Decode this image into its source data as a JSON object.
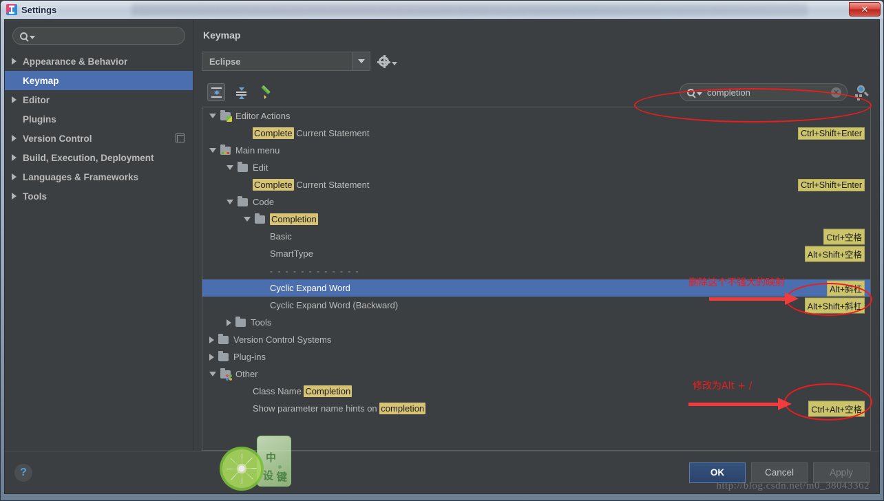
{
  "window": {
    "title": "Settings",
    "close_label": "✕"
  },
  "sidebar": {
    "search_placeholder": "",
    "search_value": "",
    "items": [
      {
        "label": "Appearance & Behavior",
        "expandable": true,
        "selected": false,
        "badge": false
      },
      {
        "label": "Keymap",
        "expandable": false,
        "selected": true,
        "badge": false
      },
      {
        "label": "Editor",
        "expandable": true,
        "selected": false,
        "badge": false
      },
      {
        "label": "Plugins",
        "expandable": false,
        "selected": false,
        "badge": false
      },
      {
        "label": "Version Control",
        "expandable": true,
        "selected": false,
        "badge": true
      },
      {
        "label": "Build, Execution, Deployment",
        "expandable": true,
        "selected": false,
        "badge": false
      },
      {
        "label": "Languages & Frameworks",
        "expandable": true,
        "selected": false,
        "badge": false
      },
      {
        "label": "Tools",
        "expandable": true,
        "selected": false,
        "badge": false
      }
    ]
  },
  "keymap": {
    "page_title": "Keymap",
    "selected_scheme": "Eclipse",
    "toolbar": {
      "expand_all_tooltip": "Expand All",
      "collapse_all_tooltip": "Collapse All",
      "edit_shortcut_tooltip": "Edit Shortcut"
    },
    "search": {
      "value": "completion",
      "placeholder": "",
      "clear_label": "✕"
    },
    "tree": [
      {
        "indent": 0,
        "arrow": "open",
        "icon": "folder-editor",
        "text": "Editor Actions",
        "highlight": "",
        "shortcut": "",
        "selected": false
      },
      {
        "indent": 2,
        "arrow": "none",
        "icon": "none",
        "text": "Complete Current Statement",
        "highlight": "Complete",
        "shortcut": "Ctrl+Shift+Enter",
        "selected": false
      },
      {
        "indent": 0,
        "arrow": "open",
        "icon": "folder-menu",
        "text": "Main menu",
        "highlight": "",
        "shortcut": "",
        "selected": false
      },
      {
        "indent": 1,
        "arrow": "open",
        "icon": "folder",
        "text": "Edit",
        "highlight": "",
        "shortcut": "",
        "selected": false
      },
      {
        "indent": 2,
        "arrow": "none",
        "icon": "none",
        "text": "Complete Current Statement",
        "highlight": "Complete",
        "shortcut": "Ctrl+Shift+Enter",
        "selected": false
      },
      {
        "indent": 1,
        "arrow": "open",
        "icon": "folder",
        "text": "Code",
        "highlight": "",
        "shortcut": "",
        "selected": false
      },
      {
        "indent": 2,
        "arrow": "open",
        "icon": "folder",
        "text": "Completion",
        "highlight": "Completion",
        "shortcut": "",
        "selected": false
      },
      {
        "indent": 3,
        "arrow": "none",
        "icon": "none",
        "text": "Basic",
        "highlight": "",
        "shortcut": "Ctrl+空格",
        "selected": false
      },
      {
        "indent": 3,
        "arrow": "none",
        "icon": "none",
        "text": "SmartType",
        "highlight": "",
        "shortcut": "Alt+Shift+空格",
        "selected": false
      },
      {
        "indent": 3,
        "arrow": "none",
        "icon": "none",
        "text": "- - - - - - - - - - - -",
        "highlight": "",
        "shortcut": "",
        "selected": false,
        "separator": true
      },
      {
        "indent": 3,
        "arrow": "none",
        "icon": "none",
        "text": "Cyclic Expand Word",
        "highlight": "",
        "shortcut": "Alt+斜杠",
        "selected": true
      },
      {
        "indent": 3,
        "arrow": "none",
        "icon": "none",
        "text": "Cyclic Expand Word (Backward)",
        "highlight": "",
        "shortcut": "Alt+Shift+斜杠",
        "selected": false
      },
      {
        "indent": 1,
        "arrow": "closed",
        "icon": "folder",
        "text": "Tools",
        "highlight": "",
        "shortcut": "",
        "selected": false
      },
      {
        "indent": 0,
        "arrow": "closed",
        "icon": "folder",
        "text": "Version Control Systems",
        "highlight": "",
        "shortcut": "",
        "selected": false
      },
      {
        "indent": 0,
        "arrow": "closed",
        "icon": "folder",
        "text": "Plug-ins",
        "highlight": "",
        "shortcut": "",
        "selected": false
      },
      {
        "indent": 0,
        "arrow": "open",
        "icon": "folder-other",
        "text": "Other",
        "highlight": "",
        "shortcut": "",
        "selected": false
      },
      {
        "indent": 2,
        "arrow": "none",
        "icon": "none",
        "text": "Class Name Completion",
        "highlight": "Completion",
        "shortcut": "",
        "selected": false
      },
      {
        "indent": 2,
        "arrow": "none",
        "icon": "none",
        "text": "Show parameter name hints on completion",
        "highlight": "completion",
        "shortcut": "Ctrl+Alt+空格",
        "selected": false
      }
    ]
  },
  "footer": {
    "help_label": "?",
    "ok_label": "OK",
    "cancel_label": "Cancel",
    "apply_label": "Apply",
    "watermark_url": "http://blog.csdn.net/m0_38043362"
  },
  "watermark_logo": {
    "char1": "中",
    "char2": "设",
    "char3": "键"
  },
  "annotations": [
    {
      "name": "delete-mapping-note",
      "text": "删除这个不强大的映射"
    },
    {
      "name": "change-to-alt-slash-note",
      "text": "修改为Alt + /"
    }
  ],
  "colors": {
    "accent_selection": "#4b6eaf",
    "highlight_match": "#d6c474",
    "shortcut_badge": "#cbc46b",
    "annotation_red": "#ee1c1c",
    "panel_bg": "#3c3f41"
  }
}
